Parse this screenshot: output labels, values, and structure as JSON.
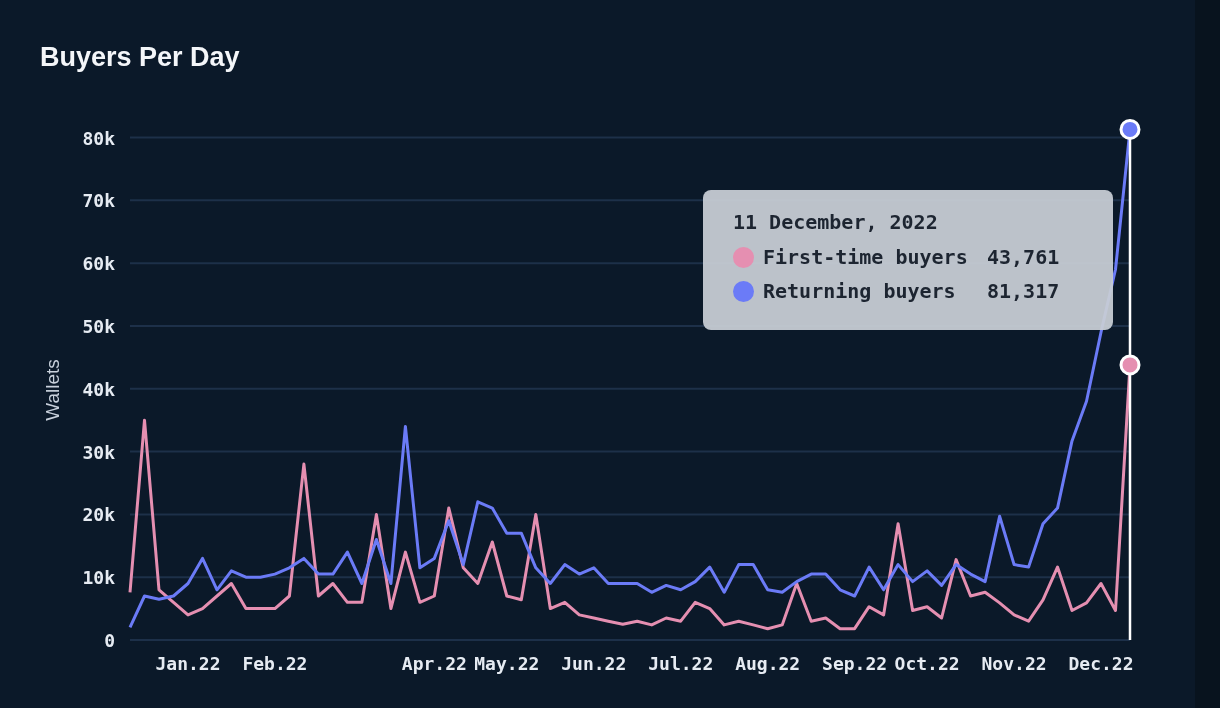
{
  "title": "Buyers Per Day",
  "chart": {
    "chart_data": {
      "type": "line",
      "ylabel": "Wallets",
      "grid": true,
      "legend": true,
      "ylim": [
        0,
        82000
      ],
      "categories": [
        null,
        null,
        null,
        null,
        "Jan.22",
        null,
        null,
        null,
        null,
        null,
        "Feb.22",
        null,
        null,
        null,
        null,
        null,
        null,
        null,
        null,
        null,
        null,
        "Apr.22",
        null,
        null,
        null,
        null,
        "May.22",
        null,
        null,
        null,
        null,
        null,
        "Jun.22",
        null,
        null,
        null,
        null,
        null,
        "Jul.22",
        null,
        null,
        null,
        null,
        null,
        "Aug.22",
        null,
        null,
        null,
        null,
        null,
        "Sep.22",
        null,
        null,
        null,
        null,
        "Oct.22",
        null,
        null,
        null,
        null,
        null,
        "Nov.22",
        null,
        null,
        null,
        null,
        null,
        "Dec.22",
        null,
        null
      ],
      "series": [
        {
          "name": "First-time buyers",
          "color": "#e58fb1",
          "values": [
            7600,
            35000,
            8000,
            6000,
            4000,
            5000,
            7000,
            9000,
            5000,
            5000,
            5000,
            7000,
            28000,
            7000,
            9000,
            6000,
            6000,
            20000,
            5000,
            14000,
            6000,
            7000,
            21000,
            11500,
            9000,
            15600,
            7000,
            6400,
            20000,
            5000,
            6000,
            4000,
            3500,
            3000,
            2500,
            3000,
            2400,
            3500,
            3000,
            6000,
            5000,
            2400,
            3000,
            2400,
            1800,
            2400,
            9000,
            3000,
            3500,
            1800,
            1800,
            5300,
            4000,
            18500,
            4700,
            5300,
            3500,
            12800,
            7000,
            7600,
            5900,
            4000,
            3000,
            6400,
            11600,
            4700,
            5900,
            9000,
            4700,
            43800
          ]
        },
        {
          "name": "Returning buyers",
          "color": "#6b7bf7",
          "values": [
            2000,
            7000,
            6500,
            7000,
            9000,
            13000,
            8000,
            11000,
            10000,
            10000,
            10500,
            11500,
            13000,
            10500,
            10500,
            14000,
            9000,
            16000,
            9000,
            34000,
            11500,
            13000,
            19000,
            12000,
            22000,
            21000,
            17000,
            17000,
            11500,
            9000,
            12000,
            10500,
            11500,
            9000,
            9000,
            9000,
            7600,
            8700,
            8000,
            9300,
            11600,
            7600,
            12000,
            12000,
            8000,
            7600,
            9300,
            10500,
            10500,
            8000,
            7000,
            11600,
            8000,
            12000,
            9300,
            11000,
            8700,
            12000,
            10500,
            9300,
            19700,
            12000,
            11600,
            18500,
            21000,
            31700,
            38000,
            49000,
            59000,
            81300
          ]
        }
      ],
      "yticks": [
        {
          "value": 0,
          "label": "0"
        },
        {
          "value": 10000,
          "label": "10k"
        },
        {
          "value": 20000,
          "label": "20k"
        },
        {
          "value": 30000,
          "label": "30k"
        },
        {
          "value": 40000,
          "label": "40k"
        },
        {
          "value": 50000,
          "label": "50k"
        },
        {
          "value": 60000,
          "label": "60k"
        },
        {
          "value": 70000,
          "label": "70k"
        },
        {
          "value": 80000,
          "label": "80k"
        }
      ]
    }
  },
  "tooltip": {
    "date": "11 December, 2022",
    "values": [
      "43,761",
      "81,317"
    ]
  }
}
